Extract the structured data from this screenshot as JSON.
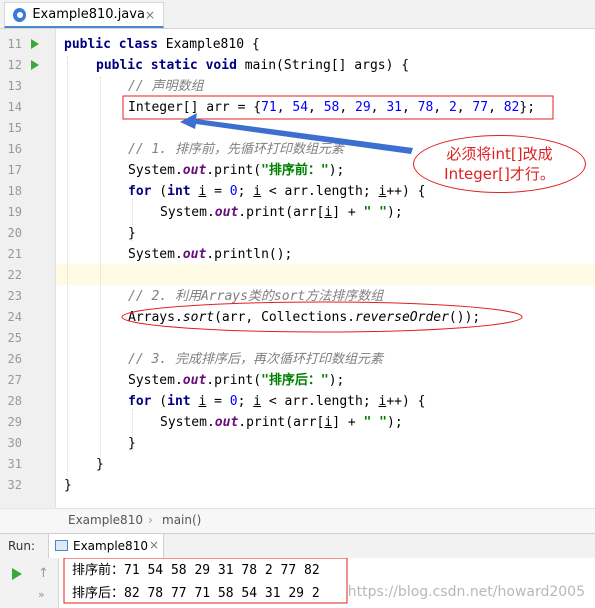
{
  "tab": {
    "title": "Example810.java",
    "close": "×"
  },
  "gutter": {
    "line_numbers": [
      "11",
      "12",
      "13",
      "14",
      "15",
      "16",
      "17",
      "18",
      "19",
      "20",
      "21",
      "22",
      "23",
      "24",
      "25",
      "26",
      "27",
      "28",
      "29",
      "30",
      "31",
      "32"
    ]
  },
  "code": {
    "l11": {
      "kw1": "public",
      "kw2": "class",
      "rest": " Example810 {"
    },
    "l12": {
      "kw1": "public",
      "kw2": "static",
      "kw3": "void",
      "rest": " main(String[] args) {"
    },
    "l13": "// 声明数组",
    "l14": {
      "a": "Integer[] arr = {",
      "n1": "71",
      "n2": "54",
      "n3": "58",
      "n4": "29",
      "n5": "31",
      "n6": "78",
      "n7": "2",
      "n8": "77",
      "n9": "82",
      "z": "};"
    },
    "l16": "// 1. 排序前，先循环打印数组元素",
    "l17": {
      "a": "System.",
      "f": "out",
      "b": ".print(",
      "s": "\"排序前：\"",
      "c": ");"
    },
    "l18": {
      "kw1": "for",
      "p1": " (",
      "kw2": "int",
      "p2": " ",
      "i1": "i",
      "p3": " = ",
      "n": "0",
      "p4": "; ",
      "i2": "i",
      "p5": " < arr.length; ",
      "i3": "i",
      "p6": "++) {"
    },
    "l19": {
      "a": "System.",
      "f": "out",
      "b": ".print(arr[",
      "i": "i",
      "c": "] + ",
      "s": "\" \"",
      "d": ");"
    },
    "l20": "}",
    "l21": {
      "a": "System.",
      "f": "out",
      "b": ".println();"
    },
    "l23": "// 2. 利用Arrays类的sort方法排序数组",
    "l24": {
      "a": "Arrays.",
      "m1": "sort",
      "b": "(arr, Collections.",
      "m2": "reverseOrder",
      "c": "());"
    },
    "l26": "// 3. 完成排序后，再次循环打印数组元素",
    "l27": {
      "a": "System.",
      "f": "out",
      "b": ".print(",
      "s": "\"排序后：\"",
      "c": ");"
    },
    "l28": {
      "kw1": "for",
      "p1": " (",
      "kw2": "int",
      "p2": " ",
      "i1": "i",
      "p3": " = ",
      "n": "0",
      "p4": "; ",
      "i2": "i",
      "p5": " < arr.length; ",
      "i3": "i",
      "p6": "++) {"
    },
    "l29": {
      "a": "System.",
      "f": "out",
      "b": ".print(arr[",
      "i": "i",
      "c": "] + ",
      "s": "\" \"",
      "d": ");"
    },
    "l30": "}",
    "l31": "}",
    "l32": "}"
  },
  "annotation": {
    "line1": "必须将int[]改成",
    "line2": "Integer[]才行。"
  },
  "breadcrumb": {
    "class": "Example810",
    "separator": "›",
    "method": "main()"
  },
  "run_panel": {
    "label": "Run:",
    "config": "Example810",
    "close": "×",
    "output": [
      "排序前：71 54 58 29 31 78 2 77 82",
      "排序后：82 78 77 71 58 54 31 29 2"
    ]
  },
  "watermark": "https://blog.csdn.net/howard2005",
  "colors": {
    "keyword": "#000080",
    "comment": "#808080",
    "number": "#0000ff",
    "string": "#008000",
    "field": "#660e7a",
    "annotation": "#e02020",
    "arrow": "#3d6fd1",
    "run_icon": "#39a939"
  }
}
